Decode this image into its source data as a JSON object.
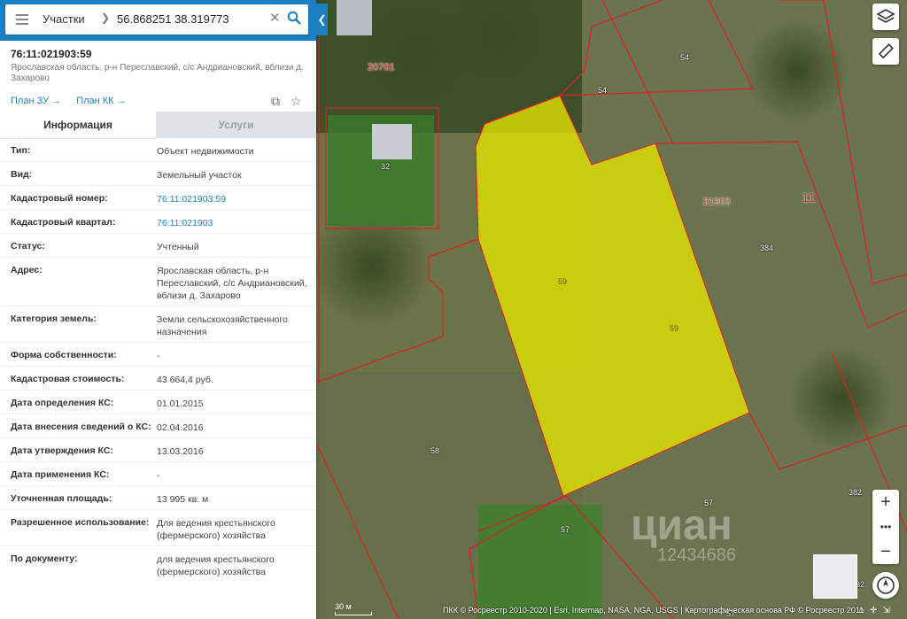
{
  "search": {
    "type": "Участки",
    "value": "56.868251 38.319773"
  },
  "card": {
    "title": "76:11:021903:59",
    "address": "Ярославская область, р-н Переславский, с/с Андриановский, вблизи д. Захарово",
    "links": [
      "План ЗУ →",
      "План КК →"
    ]
  },
  "tabs": {
    "info": "Информация",
    "services": "Услуги"
  },
  "info_rows": [
    {
      "k": "Тип:",
      "v": "Объект недвижимости"
    },
    {
      "k": "Вид:",
      "v": "Земельный участок"
    },
    {
      "k": "Кадастровый номер:",
      "v": "76:11:021903:59"
    },
    {
      "k": "Кадастровый квартал:",
      "v": "76:11:021903"
    },
    {
      "k": "Статус:",
      "v": "Учтенный"
    },
    {
      "k": "Адрес:",
      "v": "Ярославская область, р-н Переславский, с/с Андриановский, вблизи д. Захарово"
    },
    {
      "k": "Категория земель:",
      "v": "Земли сельскохозяйственного назначения"
    },
    {
      "k": "Форма собственности:",
      "v": "-"
    },
    {
      "k": "Кадастровая стоимость:",
      "v": "43 664,4 руб."
    },
    {
      "k": "Дата определения КС:",
      "v": "01.01.2015"
    },
    {
      "k": "Дата внесения сведений о КС:",
      "v": "02.04.2016"
    },
    {
      "k": "Дата утверждения КС:",
      "v": "13.03.2016"
    },
    {
      "k": "Дата применения КС:",
      "v": "-"
    },
    {
      "k": "Уточненная площадь:",
      "v": "13 995 кв. м"
    },
    {
      "k": "Разрешенное использование:",
      "v": "Для ведения крестьянского (фермерского) хозяйства"
    },
    {
      "k": "По документу:",
      "v": "для ведения крестьянского (фермерского) хозяйства"
    }
  ],
  "map": {
    "labels": [
      "20701",
      "54",
      "54",
      "32",
      "21903",
      "11",
      "384",
      "59",
      "59",
      "58",
      "57",
      "57",
      "382",
      "57",
      "32"
    ],
    "scale": "30 м",
    "copyright": "ПКК © Росреестр 2010-2020 | Esri, Intermap, NASA, NGA, USGS | Картографическая основа РФ © Росреестр 2011",
    "watermark": "циан",
    "watermark_id": "12434686"
  },
  "colors": {
    "header": "#1c7fc4",
    "parcel_fill": "#e6e600",
    "boundary": "#e02020"
  }
}
